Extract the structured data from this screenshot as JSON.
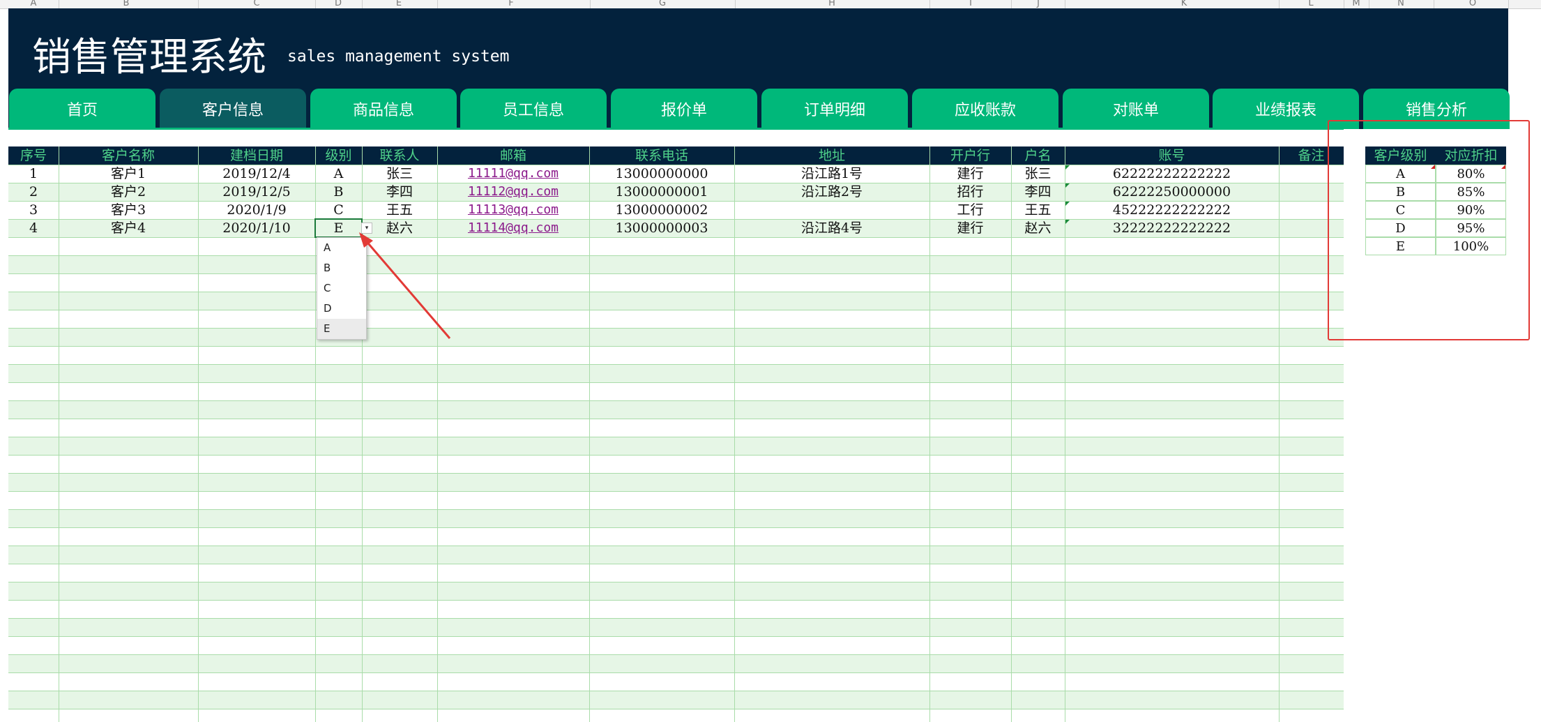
{
  "sheet": {
    "column_letters": [
      "A",
      "B",
      "C",
      "D",
      "E",
      "F",
      "G",
      "H",
      "I",
      "J",
      "K",
      "L",
      "M",
      "N",
      "O"
    ]
  },
  "header": {
    "title": "销售管理系统",
    "subtitle": "sales management system"
  },
  "tabs": [
    {
      "label": "首页",
      "active": false
    },
    {
      "label": "客户信息",
      "active": true
    },
    {
      "label": "商品信息",
      "active": false
    },
    {
      "label": "员工信息",
      "active": false
    },
    {
      "label": "报价单",
      "active": false
    },
    {
      "label": "订单明细",
      "active": false
    },
    {
      "label": "应收账款",
      "active": false
    },
    {
      "label": "对账单",
      "active": false
    },
    {
      "label": "业绩报表",
      "active": false
    },
    {
      "label": "销售分析",
      "active": false
    }
  ],
  "table": {
    "columns": [
      "序号",
      "客户名称",
      "建档日期",
      "级别",
      "联系人",
      "邮箱",
      "联系电话",
      "地址",
      "开户行",
      "户名",
      "账号",
      "备注"
    ],
    "rows": [
      [
        "1",
        "客户1",
        "2019/12/4",
        "A",
        "张三",
        "11111@qq.com",
        "13000000000",
        "沿江路1号",
        "建行",
        "张三",
        "62222222222222",
        ""
      ],
      [
        "2",
        "客户2",
        "2019/12/5",
        "B",
        "李四",
        "11112@qq.com",
        "13000000001",
        "沿江路2号",
        "招行",
        "李四",
        "62222250000000",
        ""
      ],
      [
        "3",
        "客户3",
        "2020/1/9",
        "C",
        "王五",
        "11113@qq.com",
        "13000000002",
        "工行",
        "王五",
        "45222222222222",
        ""
      ],
      [
        "4",
        "客户4",
        "2020/1/10",
        "E",
        "赵六",
        "11114@qq.com",
        "13000000003",
        "沿江路4号",
        "建行",
        "赵六",
        "32222222222222",
        ""
      ]
    ]
  },
  "level_dropdown": {
    "selected": "E",
    "options": [
      "A",
      "B",
      "C",
      "D",
      "E"
    ]
  },
  "discount_table": {
    "headers": [
      "客户级别",
      "对应折扣"
    ],
    "rows": [
      [
        "A",
        "80%"
      ],
      [
        "B",
        "85%"
      ],
      [
        "C",
        "90%"
      ],
      [
        "D",
        "95%"
      ],
      [
        "E",
        "100%"
      ]
    ]
  },
  "colors": {
    "banner": "#03223d",
    "tab": "#00b87a",
    "tab_active": "#0b5c60",
    "header_text": "#4fd28a",
    "stripe": "#e6f6e6",
    "annotation": "#e23a36"
  }
}
